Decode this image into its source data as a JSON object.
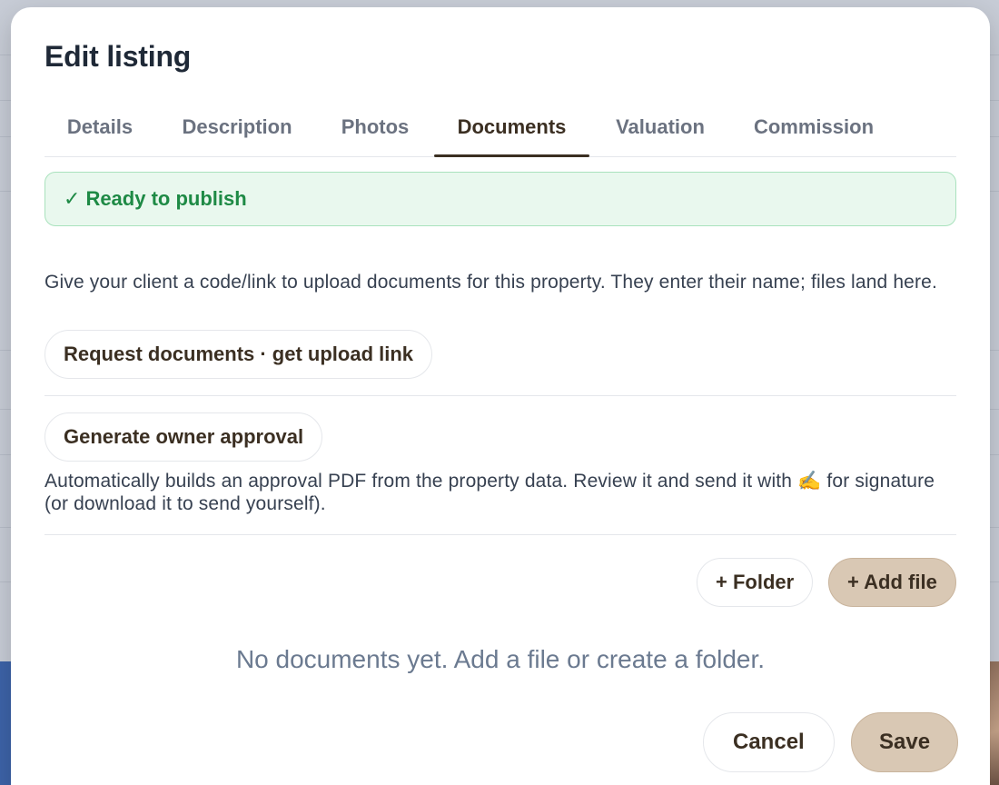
{
  "modal": {
    "title": "Edit listing",
    "tabs": [
      {
        "label": "Details"
      },
      {
        "label": "Description"
      },
      {
        "label": "Photos"
      },
      {
        "label": "Documents"
      },
      {
        "label": "Valuation"
      },
      {
        "label": "Commission"
      }
    ],
    "active_tab": "Documents",
    "status_banner": {
      "icon": "✓",
      "text": "Ready to publish",
      "color": "#1e8a45"
    },
    "request_section": {
      "description": "Give your client a code/link to upload documents for this property. They enter their name; files land here.",
      "button_label": "Request documents · get upload link"
    },
    "approval_section": {
      "button_label": "Generate owner approval",
      "description": "Automatically builds an approval PDF from the property data. Review it and send it with ✍️ for signature (or download it to send yourself)."
    },
    "files": {
      "folder_button": "+ Folder",
      "add_file_button": "+ Add file",
      "empty_text": "No documents yet. Add a file or create a folder."
    },
    "footer": {
      "cancel_label": "Cancel",
      "save_label": "Save"
    }
  },
  "colors": {
    "accent": "#3b2f22",
    "primary_button": "#d9c8b4",
    "success": "#1e8a45",
    "success_bg": "#e9f8ee"
  }
}
